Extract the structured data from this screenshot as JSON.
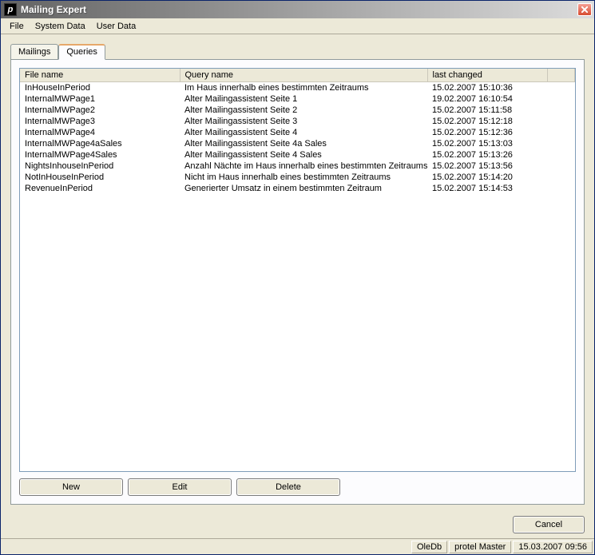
{
  "window": {
    "title": "Mailing Expert"
  },
  "menu": {
    "file": "File",
    "system_data": "System Data",
    "user_data": "User Data"
  },
  "tabs": {
    "mailings": "Mailings",
    "queries": "Queries",
    "active": "queries"
  },
  "columns": {
    "file_name": "File name",
    "query_name": "Query name",
    "last_changed": "last changed"
  },
  "rows": [
    {
      "file": "InHouseInPeriod",
      "query": "Im Haus innerhalb eines bestimmten Zeitraums",
      "changed": "15.02.2007 15:10:36"
    },
    {
      "file": "InternalMWPage1",
      "query": "Alter Mailingassistent Seite 1",
      "changed": "19.02.2007 16:10:54"
    },
    {
      "file": "InternalMWPage2",
      "query": "Alter Mailingassistent Seite 2",
      "changed": "15.02.2007 15:11:58"
    },
    {
      "file": "InternalMWPage3",
      "query": "Alter Mailingassistent Seite 3",
      "changed": "15.02.2007 15:12:18"
    },
    {
      "file": "InternalMWPage4",
      "query": "Alter Mailingassistent Seite 4",
      "changed": "15.02.2007 15:12:36"
    },
    {
      "file": "InternalMWPage4aSales",
      "query": "Alter Mailingassistent Seite 4a Sales",
      "changed": "15.02.2007 15:13:03"
    },
    {
      "file": "InternalMWPage4Sales",
      "query": "Alter Mailingassistent Seite 4 Sales",
      "changed": "15.02.2007 15:13:26"
    },
    {
      "file": "NightsInhouseInPeriod",
      "query": "Anzahl Nächte im Haus innerhalb eines bestimmten Zeitraums",
      "changed": "15.02.2007 15:13:56"
    },
    {
      "file": "NotInHouseInPeriod",
      "query": "Nicht im Haus innerhalb eines bestimmten Zeitraums",
      "changed": "15.02.2007 15:14:20"
    },
    {
      "file": "RevenueInPeriod",
      "query": "Generierter Umsatz in einem bestimmten Zeitraum",
      "changed": "15.02.2007 15:14:53"
    }
  ],
  "buttons": {
    "new": "New",
    "edit": "Edit",
    "delete": "Delete",
    "cancel": "Cancel"
  },
  "status": {
    "db": "OleDb",
    "user": "protel Master",
    "datetime": "15.03.2007 09:56"
  }
}
